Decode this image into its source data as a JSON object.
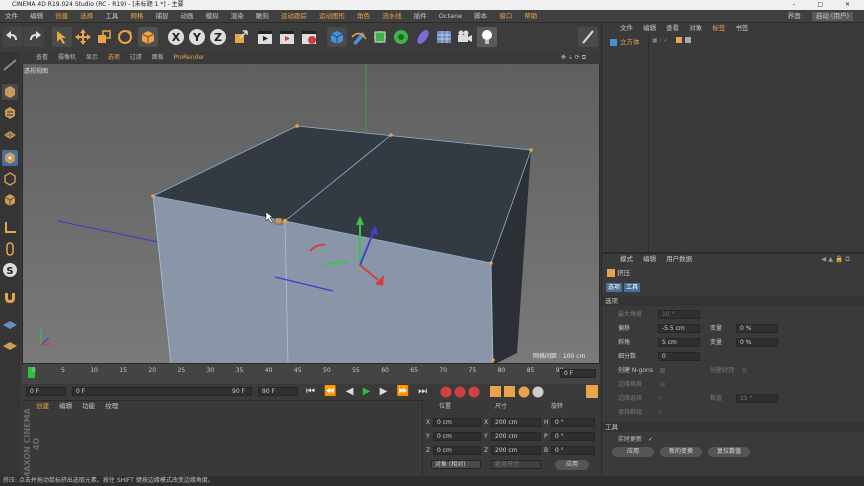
{
  "app": {
    "title": "CINEMA 4D R19.024 Studio (RC - R19) - [未标题 1 *] - 主要",
    "window_controls": "– □ ✕"
  },
  "menubar": {
    "items": [
      "文件",
      "编辑",
      "创建",
      "选择",
      "工具",
      "网格",
      "捕捉",
      "动画",
      "模拟",
      "渲染",
      "雕刻",
      "运动跟踪",
      "运动图形",
      "角色",
      "流水线",
      "插件",
      "Octane",
      "脚本",
      "窗口",
      "帮助"
    ],
    "layout_label": "界面:",
    "layout_value": "启动 (用户)"
  },
  "viewport": {
    "menu": [
      "查看",
      "摄像机",
      "显示",
      "选项",
      "过滤",
      "面板",
      "ProRender"
    ],
    "active_menu": "选项",
    "label": "透视视图",
    "grid_info": "网格间距 : 100 cm"
  },
  "timeline": {
    "ticks": [
      "0",
      "5",
      "10",
      "15",
      "20",
      "25",
      "30",
      "35",
      "40",
      "45",
      "50",
      "55",
      "60",
      "65",
      "70",
      "75",
      "80",
      "85",
      "90"
    ],
    "frame_right": "0 F",
    "start": "0 F",
    "current": "0 F",
    "end_a": "90 F",
    "end_b": "90 F"
  },
  "materials": {
    "menu": [
      "创建",
      "编辑",
      "功能",
      "纹理"
    ],
    "logo": "MAXON CINEMA 4D"
  },
  "coords": {
    "headers": [
      "位置",
      "尺寸",
      "旋转"
    ],
    "rows": [
      {
        "axis": "X",
        "pos": "0 cm",
        "size_axis": "X",
        "size": "200 cm",
        "rot_axis": "H",
        "rot": "0 °"
      },
      {
        "axis": "Y",
        "pos": "0 cm",
        "size_axis": "Y",
        "size": "200 cm",
        "rot_axis": "P",
        "rot": "0 °"
      },
      {
        "axis": "Z",
        "pos": "0 cm",
        "size_axis": "Z",
        "size": "200 cm",
        "rot_axis": "B",
        "rot": "0 °"
      }
    ],
    "mode": "对象 (相对)",
    "size_mode": "绝对尺寸",
    "apply": "应用"
  },
  "object_manager": {
    "menu": [
      "文件",
      "编辑",
      "查看",
      "对象",
      "标签",
      "书签"
    ],
    "object_name": "立方体"
  },
  "attributes": {
    "menu": [
      "模式",
      "编辑",
      "用户数据"
    ],
    "tool_name": "挤压",
    "tabs": [
      "选项",
      "工具"
    ],
    "section_options": "选项",
    "max_angle_label": "最大角度",
    "max_angle": "10 °",
    "offset_label": "偏移",
    "offset": "-5.5 cm",
    "var1_label": "变量",
    "var1": "0 %",
    "bevel_label": "斜角",
    "bevel": "5 cm",
    "var2_label": "变量",
    "var2": "0 %",
    "subdiv_label": "细分数",
    "subdiv": "0",
    "ngons_label": "创建 N-gons",
    "caps_label": "创建封顶",
    "edge_angle_label": "边缘角度",
    "edge_angle_sel_label": "边缘选择",
    "value_label": "数值",
    "value": "15 °",
    "keep_groups_label": "保持群组",
    "section_tool": "工具",
    "realtime_label": "实时更新",
    "btn_apply": "应用",
    "btn_new": "新的变换",
    "btn_reset": "复位数值"
  },
  "status": "挤压: 点击并拖动鼠标挤出选取元素。按住 SHIFT 键按边缘模式改变边缘角度。",
  "colors": {
    "accent": "#e9a34a",
    "panel": "#3a3a3a",
    "viewport_bg": "#6e6e6e",
    "cube_top": "#343a42",
    "cube_front": "#8a96a8",
    "cube_side": "#2c3036",
    "axis_green": "#38c24e",
    "axis_red": "#d04040",
    "axis_blue": "#4040d0",
    "play_green": "#2fbf3f"
  }
}
